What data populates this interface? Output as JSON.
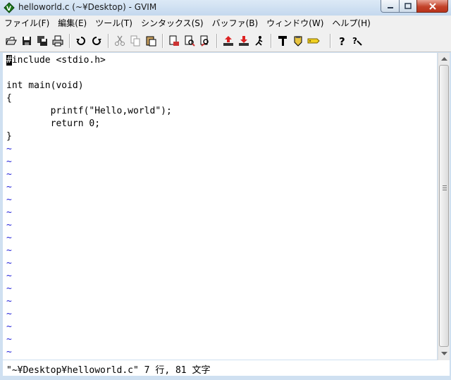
{
  "window": {
    "title": "helloworld.c (~¥Desktop) - GVIM"
  },
  "menu": [
    "ファイル(F)",
    "編集(E)",
    "ツール(T)",
    "シンタックス(S)",
    "バッファ(B)",
    "ウィンドウ(W)",
    "ヘルプ(H)"
  ],
  "toolbar": {
    "icons": [
      "open-icon",
      "save-icon",
      "save-all-icon",
      "print-icon",
      "undo-icon",
      "redo-icon",
      "cut-icon",
      "copy-icon",
      "paste-icon",
      "replace-icon",
      "find-next-icon",
      "find-prev-icon",
      "load-session-icon",
      "save-session-icon",
      "run-script-icon",
      "make-icon",
      "shell-icon",
      "ctags-icon",
      "help-icon",
      "find-help-icon"
    ]
  },
  "editor": {
    "lines": [
      {
        "cursor": "#",
        "text": "include <stdio.h>"
      },
      {
        "text": ""
      },
      {
        "text": "int main(void)"
      },
      {
        "text": "{"
      },
      {
        "text": "        printf(\"Hello,world\");"
      },
      {
        "text": "        return 0;"
      },
      {
        "text": "}"
      }
    ],
    "tilde": "~",
    "tilde_count": 17
  },
  "status": {
    "text": "\"~¥Desktop¥helloworld.c\" 7 行, 81 文字"
  },
  "colors": {
    "tilde": "#2424d8",
    "close_button": "#c3432b"
  }
}
